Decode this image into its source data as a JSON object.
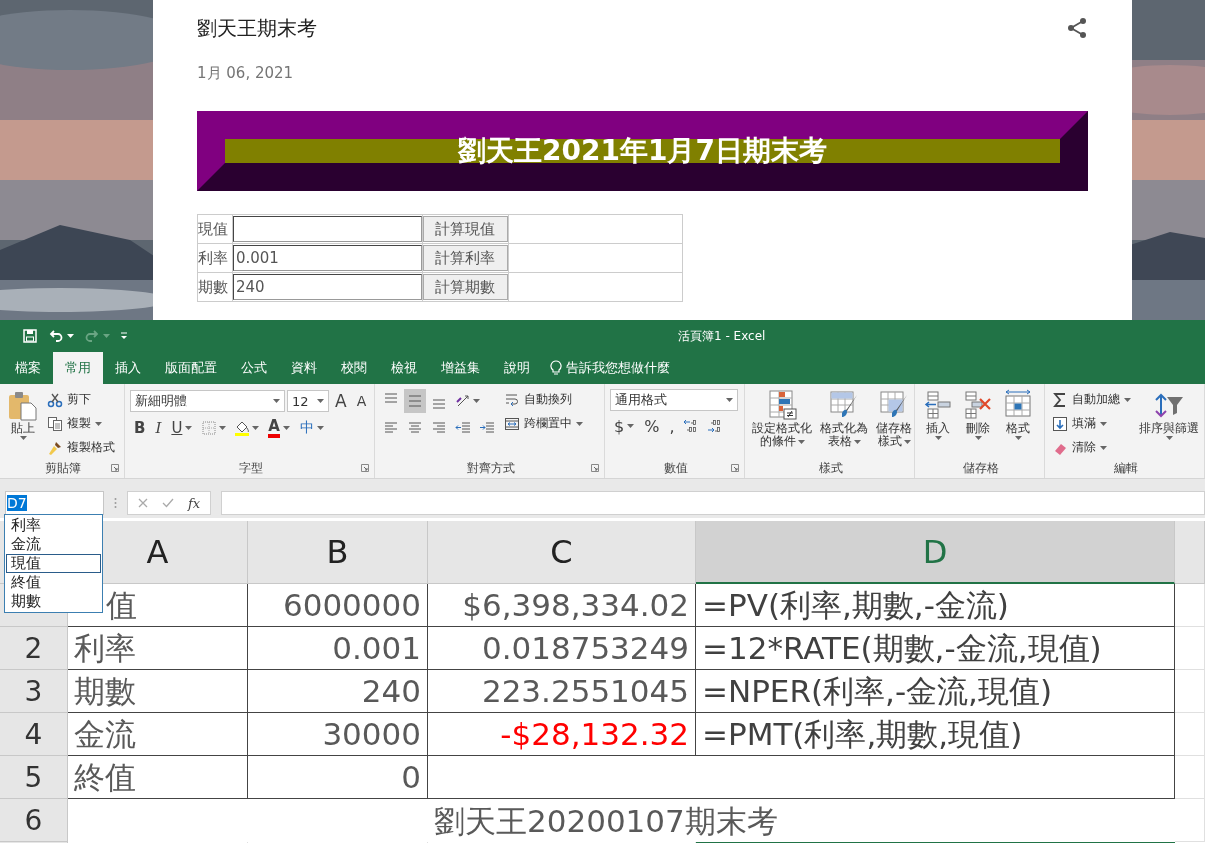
{
  "post": {
    "title": "劉天王期末考",
    "date": "1月 06, 2021",
    "banner": "劉天王2021年1月7日期末考",
    "form": [
      {
        "label": "現值",
        "button": "計算現值"
      },
      {
        "label": "利率",
        "value": "0.001",
        "button": "計算利率"
      },
      {
        "label": "期數",
        "value": "240",
        "button": "計算期數"
      }
    ]
  },
  "excel": {
    "title": "活頁簿1  -  Excel",
    "redo_enabled": false,
    "tabs": [
      {
        "label": "檔案",
        "selected": false
      },
      {
        "label": "常用",
        "selected": true
      },
      {
        "label": "插入",
        "selected": false
      },
      {
        "label": "版面配置",
        "selected": false
      },
      {
        "label": "公式",
        "selected": false
      },
      {
        "label": "資料",
        "selected": false
      },
      {
        "label": "校閱",
        "selected": false
      },
      {
        "label": "檢視",
        "selected": false
      },
      {
        "label": "增益集",
        "selected": false
      },
      {
        "label": "說明",
        "selected": false
      }
    ],
    "tell_me": "告訴我您想做什麼",
    "ribbon": [
      {
        "label": "剪貼簿",
        "launcher": true,
        "items": [
          {
            "kind": "large",
            "label": "貼上",
            "dropdown": true
          },
          {
            "kind": "column",
            "items": [
              {
                "kind": "small",
                "label": "剪下"
              },
              {
                "kind": "small",
                "label": "複製",
                "dropdown": true
              },
              {
                "kind": "small",
                "label": "複製格式"
              }
            ]
          }
        ]
      },
      {
        "label": "字型",
        "launcher": true,
        "items": [
          {
            "kind": "column",
            "items": [
              {
                "kind": "row",
                "items": [
                  {
                    "kind": "field",
                    "value": "新細明體"
                  },
                  {
                    "kind": "field",
                    "value": "12"
                  },
                  {
                    "kind": "glyph",
                    "label": "A"
                  },
                  {
                    "kind": "glyph",
                    "label": "A"
                  }
                ]
              },
              {
                "kind": "row",
                "items": [
                  {
                    "kind": "glyph",
                    "label": "B"
                  },
                  {
                    "kind": "glyph",
                    "label": "I"
                  },
                  {
                    "kind": "glyph",
                    "label": "U",
                    "dropdown": true
                  },
                  {
                    "kind": "icon",
                    "dropdown": true
                  },
                  {
                    "kind": "icon",
                    "dropdown": true
                  },
                  {
                    "kind": "glyph",
                    "label": "A",
                    "dropdown": true
                  },
                  {
                    "kind": "glyph",
                    "label": "中",
                    "dropdown": true
                  }
                ]
              }
            ]
          }
        ]
      },
      {
        "label": "對齊方式",
        "launcher": true,
        "items": [
          {
            "kind": "column",
            "items": [
              {
                "kind": "row",
                "items": [
                  {
                    "kind": "icon",
                    "selected": false
                  },
                  {
                    "kind": "icon",
                    "selected": true
                  },
                  {
                    "kind": "icon",
                    "selected": false
                  },
                  {
                    "kind": "icon",
                    "dropdown": true
                  }
                ]
              },
              {
                "kind": "row",
                "items": [
                  {
                    "kind": "icon",
                    "selected": false
                  },
                  {
                    "kind": "icon",
                    "selected": false
                  },
                  {
                    "kind": "icon",
                    "selected": false
                  },
                  {
                    "kind": "icon"
                  },
                  {
                    "kind": "icon"
                  }
                ]
              }
            ]
          },
          {
            "kind": "column",
            "items": [
              {
                "kind": "small",
                "label": "自動換列"
              },
              {
                "kind": "small",
                "label": "跨欄置中",
                "dropdown": true
              }
            ]
          }
        ]
      },
      {
        "label": "數值",
        "launcher": true,
        "items": [
          {
            "kind": "column",
            "items": [
              {
                "kind": "field",
                "value": "通用格式"
              },
              {
                "kind": "row",
                "items": [
                  {
                    "kind": "glyph",
                    "label": "$",
                    "dropdown": true
                  },
                  {
                    "kind": "glyph",
                    "label": "%"
                  },
                  {
                    "kind": "glyph",
                    "label": ","
                  },
                  {
                    "kind": "icon"
                  },
                  {
                    "kind": "icon"
                  }
                ]
              }
            ]
          }
        ]
      },
      {
        "label": "樣式",
        "items": [
          {
            "kind": "large",
            "label": [
              "設定格式化",
              "的條件"
            ],
            "dropdown": true
          },
          {
            "kind": "large",
            "label": [
              "格式化為",
              "表格"
            ],
            "dropdown": true
          },
          {
            "kind": "large",
            "label": [
              "儲存格",
              "樣式"
            ],
            "dropdown": true
          }
        ]
      },
      {
        "label": "儲存格",
        "items": [
          {
            "kind": "large",
            "label": "插入",
            "dropdown": true
          },
          {
            "kind": "large",
            "label": "刪除",
            "dropdown": true
          },
          {
            "kind": "large",
            "label": "格式",
            "dropdown": true
          }
        ]
      },
      {
        "label": "編輯",
        "items": [
          {
            "kind": "column",
            "items": [
              {
                "kind": "small",
                "label": "自動加總",
                "dropdown": true
              },
              {
                "kind": "small",
                "label": "填滿",
                "dropdown": true
              },
              {
                "kind": "small",
                "label": "清除",
                "dropdown": true
              }
            ]
          },
          {
            "kind": "large",
            "label": "排序與篩選",
            "dropdown": true
          }
        ]
      }
    ],
    "name_box": "D7",
    "fx": "fx",
    "name_list": [
      {
        "label": "利率",
        "selected": false
      },
      {
        "label": "金流",
        "selected": false
      },
      {
        "label": "現值",
        "selected": true
      },
      {
        "label": "終值",
        "selected": false
      },
      {
        "label": "期數",
        "selected": false
      }
    ],
    "columns": [
      {
        "label": "A",
        "selected": false
      },
      {
        "label": "B",
        "selected": false
      },
      {
        "label": "C",
        "selected": false
      },
      {
        "label": "D",
        "selected": true
      }
    ],
    "rows": [
      {
        "bordered": true,
        "cells": [
          {
            "text": "值"
          },
          {
            "text": "6000000"
          },
          {
            "text": "$6,398,334.02"
          },
          {
            "text": "=PV(利率,期數,-金流)"
          }
        ]
      },
      {
        "header": "2",
        "bordered": true,
        "cells": [
          {
            "text": "利率"
          },
          {
            "text": "0.001"
          },
          {
            "text": "0.018753249"
          },
          {
            "text": "=12*RATE(期數,-金流,現值)"
          }
        ]
      },
      {
        "header": "3",
        "bordered": true,
        "cells": [
          {
            "text": "期數"
          },
          {
            "text": "240"
          },
          {
            "text": "223.2551045"
          },
          {
            "text": "=NPER(利率,-金流,現值)"
          }
        ]
      },
      {
        "header": "4",
        "bordered": true,
        "cells": [
          {
            "text": "金流"
          },
          {
            "text": "30000"
          },
          {
            "text": "-$28,132.32",
            "negative": true
          },
          {
            "text": "=PMT(利率,期數,現值)"
          }
        ]
      },
      {
        "header": "5",
        "bordered": true,
        "cells": [
          {
            "text": "終值"
          },
          {
            "text": "0"
          },
          {
            "text": ""
          },
          {
            "text": ""
          }
        ]
      },
      {
        "header": "6",
        "bordered": false,
        "cells": [
          {
            "text": ""
          },
          {
            "text": ""
          },
          {
            "text": "劉天王20200107期末考"
          },
          {
            "text": ""
          }
        ]
      }
    ]
  }
}
